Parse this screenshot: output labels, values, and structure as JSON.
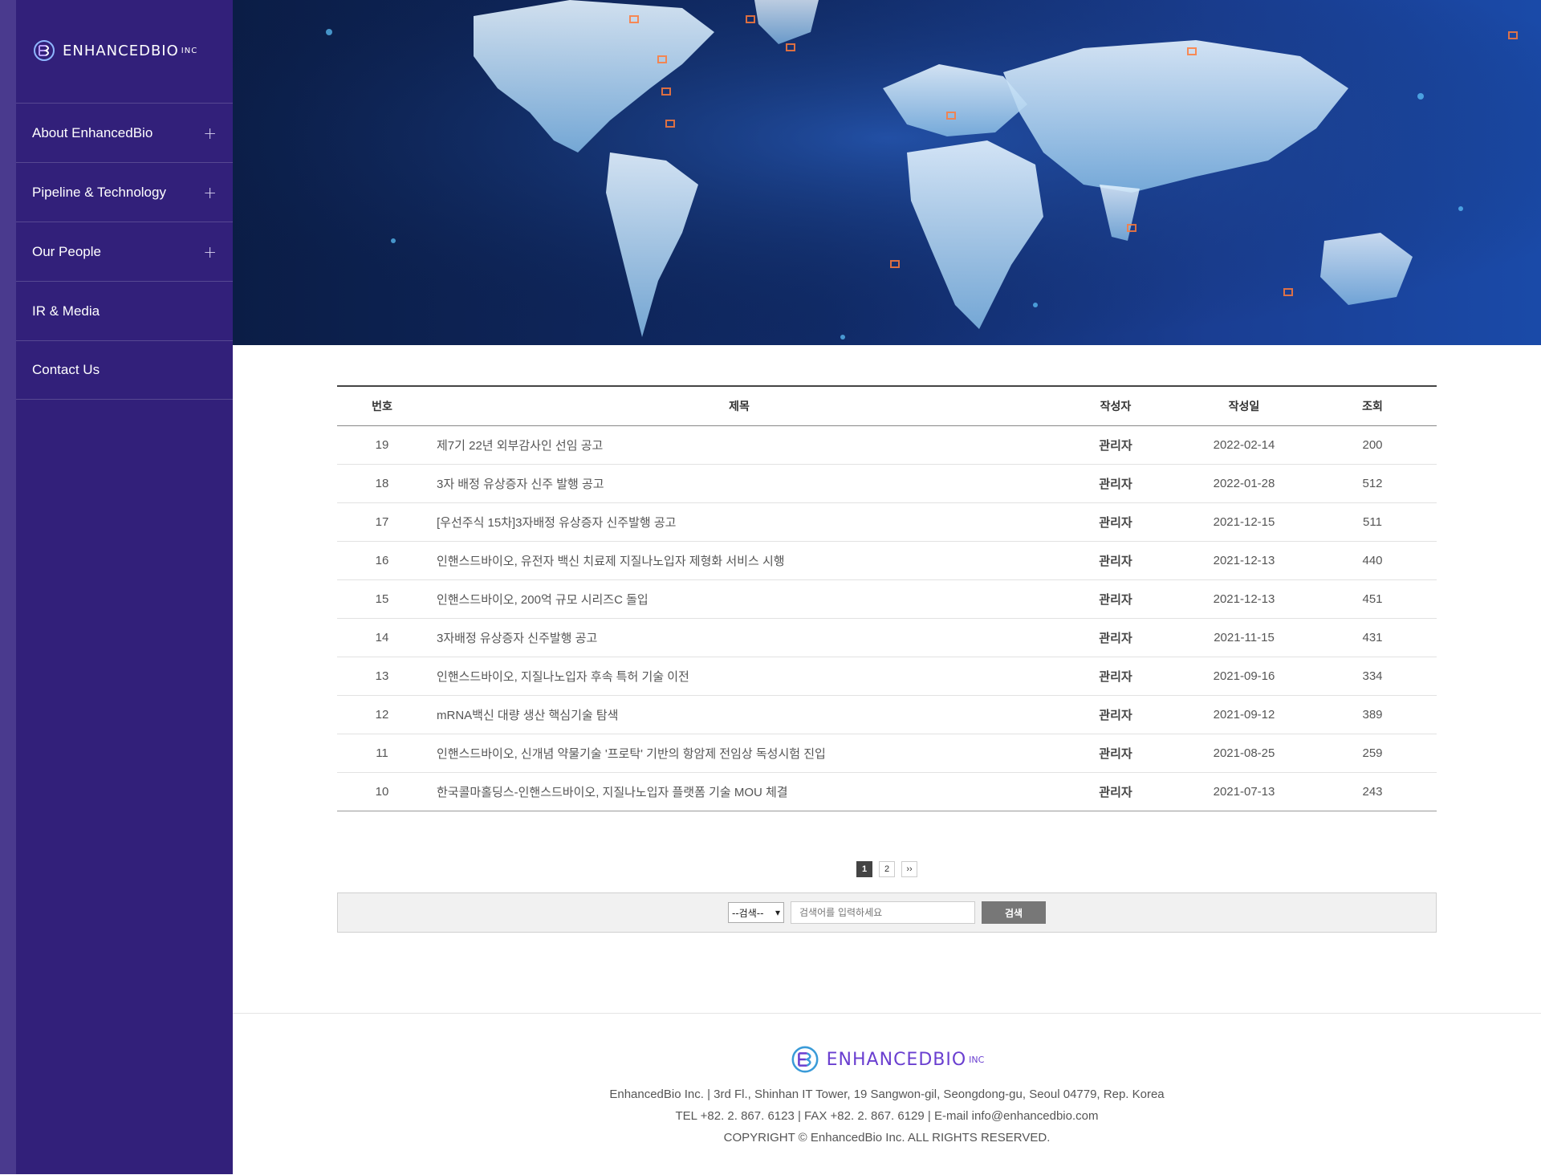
{
  "brand": {
    "name": "ENHANCEDBIO",
    "suffix": "INC"
  },
  "nav": [
    {
      "label": "About EnhancedBio",
      "has_sub": true
    },
    {
      "label": "Pipeline & Technology",
      "has_sub": true
    },
    {
      "label": "Our People",
      "has_sub": true
    },
    {
      "label": "IR & Media",
      "has_sub": false
    },
    {
      "label": "Contact Us",
      "has_sub": false
    }
  ],
  "hero": {
    "image": "world-map-network-banner"
  },
  "table": {
    "headers": {
      "no": "번호",
      "title": "제목",
      "author": "작성자",
      "date": "작성일",
      "views": "조회"
    },
    "rows": [
      {
        "no": "19",
        "title": "제7기 22년 외부감사인 선임 공고",
        "author": "관리자",
        "date": "2022-02-14",
        "views": "200"
      },
      {
        "no": "18",
        "title": "3자 배정 유상증자 신주 발행 공고",
        "author": "관리자",
        "date": "2022-01-28",
        "views": "512"
      },
      {
        "no": "17",
        "title": "[우선주식 15차]3자배정 유상증자 신주발행 공고",
        "author": "관리자",
        "date": "2021-12-15",
        "views": "511"
      },
      {
        "no": "16",
        "title": "인핸스드바이오, 유전자 백신 치료제 지질나노입자 제형화 서비스 시행",
        "author": "관리자",
        "date": "2021-12-13",
        "views": "440"
      },
      {
        "no": "15",
        "title": "인핸스드바이오, 200억 규모 시리즈C 돌입",
        "author": "관리자",
        "date": "2021-12-13",
        "views": "451"
      },
      {
        "no": "14",
        "title": "3자배정 유상증자 신주발행 공고",
        "author": "관리자",
        "date": "2021-11-15",
        "views": "431"
      },
      {
        "no": "13",
        "title": "인핸스드바이오, 지질나노입자 후속 특허 기술 이전",
        "author": "관리자",
        "date": "2021-09-16",
        "views": "334"
      },
      {
        "no": "12",
        "title": "mRNA백신 대량 생산 핵심기술 탐색",
        "author": "관리자",
        "date": "2021-09-12",
        "views": "389"
      },
      {
        "no": "11",
        "title": "인핸스드바이오, 신개념 약물기술 '프로탁' 기반의 항암제 전임상 독성시험 진입",
        "author": "관리자",
        "date": "2021-08-25",
        "views": "259"
      },
      {
        "no": "10",
        "title": "한국콜마홀딩스-인핸스드바이오, 지질나노입자 플랫폼 기술 MOU 체결",
        "author": "관리자",
        "date": "2021-07-13",
        "views": "243"
      }
    ]
  },
  "pagination": {
    "pages": [
      "1",
      "2"
    ],
    "current": "1",
    "next": "››"
  },
  "search": {
    "select_value": "--검색--",
    "placeholder": "검색어를 입력하세요",
    "button": "검색"
  },
  "footer": {
    "address": "EnhancedBio Inc. | 3rd Fl., Shinhan IT Tower, 19 Sangwon-gil, Seongdong-gu, Seoul 04779, Rep. Korea",
    "contact": "TEL +82. 2. 867. 6123 | FAX +82. 2. 867. 6129 | E-mail info@enhancedbio.com",
    "copyright": "COPYRIGHT © EnhancedBio Inc. ALL RIGHTS RESERVED."
  },
  "colors": {
    "sidebar": "#32207a",
    "brand_purple": "#6a3fd0",
    "active_page": "#444444"
  }
}
